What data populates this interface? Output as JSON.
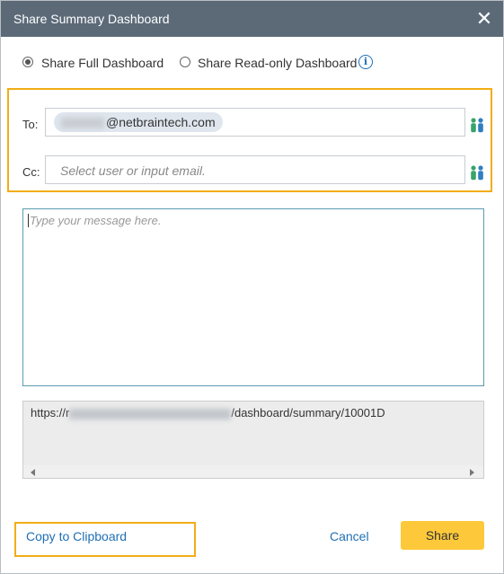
{
  "dialog": {
    "title": "Share Summary Dashboard",
    "close_icon": "close-icon"
  },
  "share_mode": {
    "options": [
      {
        "label": "Share Full Dashboard",
        "selected": true
      },
      {
        "label": "Share Read-only Dashboard",
        "selected": false
      }
    ],
    "info_icon": "info-icon"
  },
  "recipients": {
    "to_label": "To:",
    "to_chip": "@netbraintech.com",
    "cc_label": "Cc:",
    "cc_placeholder": "Select user or input email.",
    "user_picker_icon": "user-group-icon"
  },
  "message": {
    "placeholder": "Type your message here."
  },
  "link": {
    "prefix": "https://r",
    "suffix": "/dashboard/summary/10001D"
  },
  "footer": {
    "copy_label": "Copy to Clipboard",
    "cancel_label": "Cancel",
    "share_label": "Share"
  },
  "colors": {
    "titlebar": "#5c6a78",
    "highlight": "#f2ad16",
    "primary_button": "#fdc93a",
    "link": "#1f6fb5"
  }
}
